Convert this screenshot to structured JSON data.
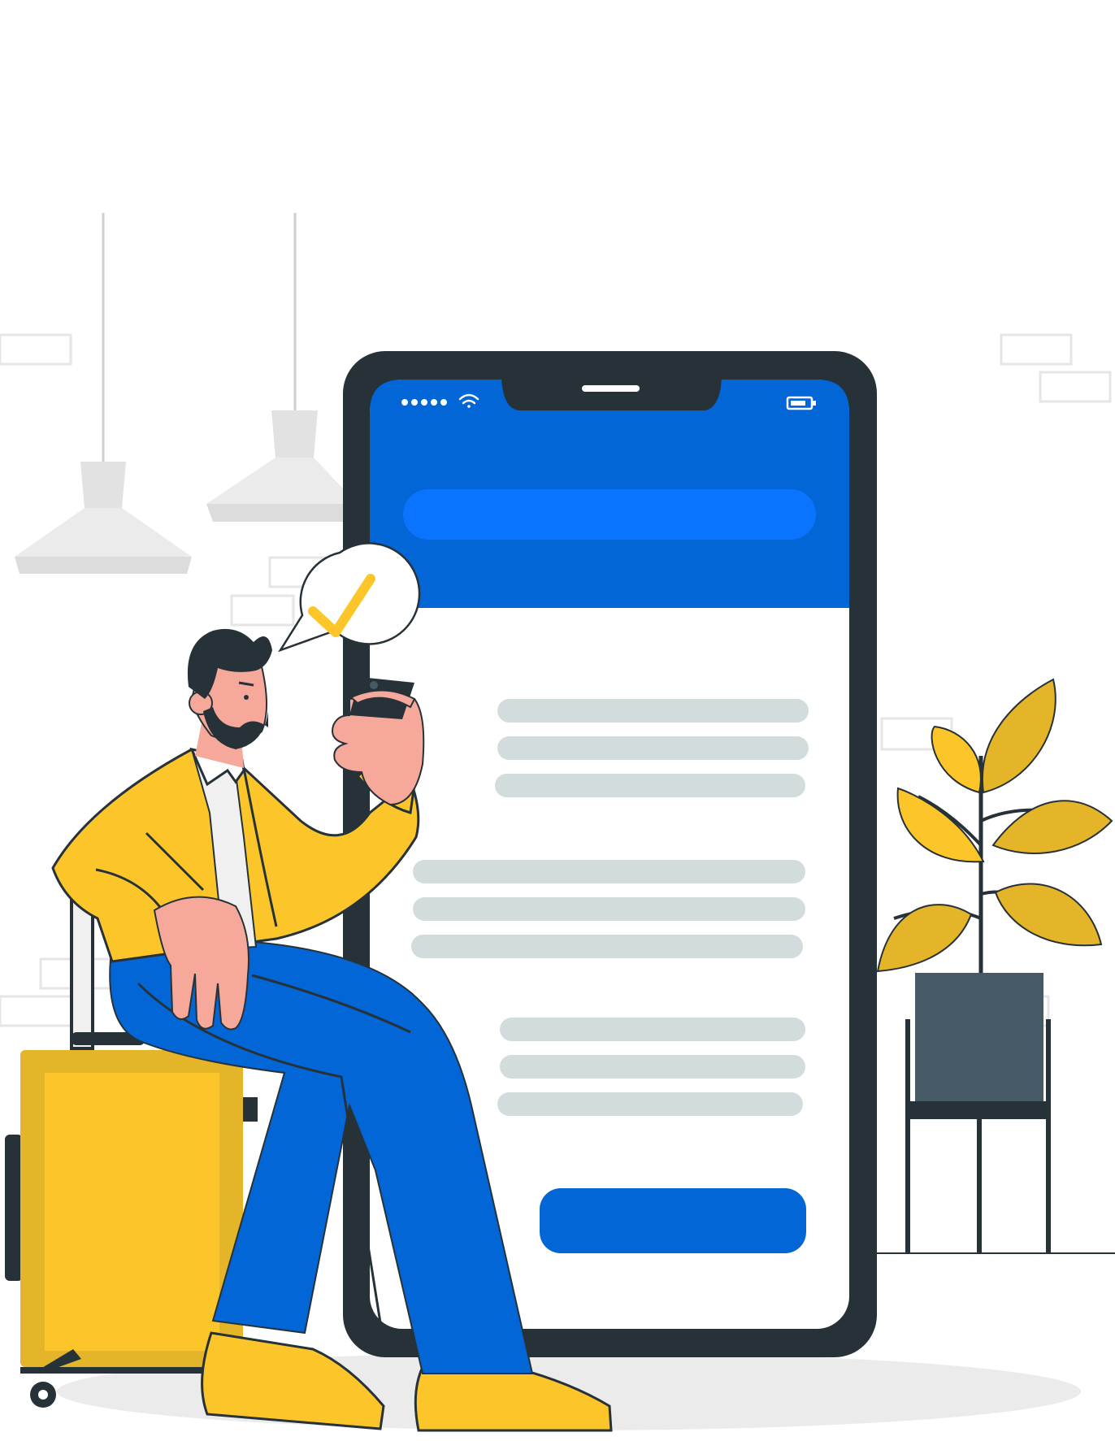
{
  "illustration": {
    "palette": {
      "brand_blue": "#0366d6",
      "bright_blue": "#0a74ff",
      "phone_frame": "#263238",
      "accent_yellow": "#fcc62b",
      "yellow_shade": "#e4b429",
      "skin": "#f6a89b",
      "skeleton_gray": "#d2dcdc",
      "lamp_gray": "#e2e2e2",
      "pot_gray": "#455a64"
    },
    "icons": {
      "signal": "signal-dots-icon",
      "wifi": "wifi-icon",
      "battery": "battery-icon",
      "confirm": "checkmark-icon"
    }
  }
}
